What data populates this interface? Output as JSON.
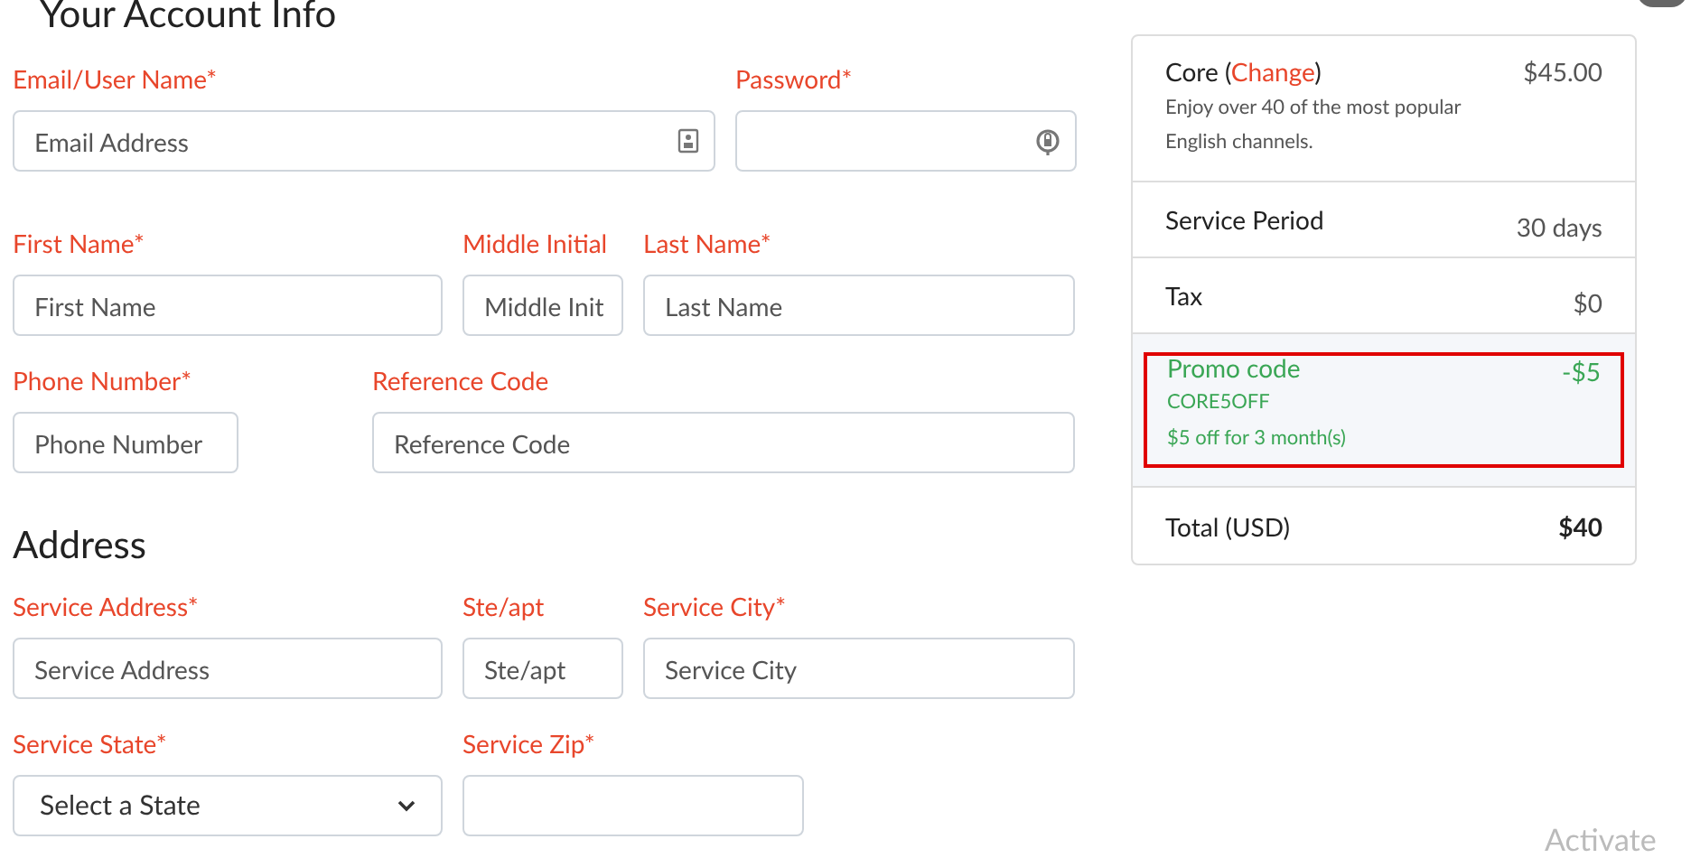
{
  "account": {
    "title": "Your Account Info",
    "fields": [
      {
        "label": "Email/User Name*",
        "placeholder": "Email Address",
        "kind": "email"
      },
      {
        "label": "Password*",
        "kind": "password"
      },
      {
        "label": "First Name*",
        "placeholder": "First Name",
        "kind": "text"
      },
      {
        "label": "Middle Initial",
        "placeholder": "Middle Init",
        "kind": "text"
      },
      {
        "label": "Last Name*",
        "placeholder": "Last Name",
        "kind": "text"
      },
      {
        "label": "Phone Number*",
        "placeholder": "Phone Number",
        "kind": "text"
      },
      {
        "label": "Reference Code",
        "placeholder": "Reference Code",
        "kind": "text"
      }
    ]
  },
  "address": {
    "title": "Address",
    "fields": [
      {
        "label": "Service Address*",
        "placeholder": "Service Address",
        "kind": "text"
      },
      {
        "label": "Ste/apt",
        "placeholder": "Ste/apt",
        "kind": "text"
      },
      {
        "label": "Service City*",
        "placeholder": "Service City",
        "kind": "text"
      },
      {
        "label": "Service State*",
        "value": "Select a State",
        "kind": "select"
      },
      {
        "label": "Service Zip*",
        "kind": "text"
      }
    ]
  },
  "package": {
    "plan": {
      "name": "Core",
      "open": "(",
      "link": "Change",
      "close": ")",
      "price": "$45.00",
      "description": "Enjoy over 40 of the most popular English channels."
    },
    "rows": [
      {
        "label": "Service Period",
        "value": "30 days",
        "kind": "line"
      },
      {
        "label": "Tax",
        "value": "$0",
        "kind": "line"
      },
      {
        "label": "Promo code",
        "code": "CORE5OFF",
        "note": "$5 off for 3 month(s)",
        "value": "-$5",
        "kind": "promo",
        "highlighted": true
      },
      {
        "label": "Total (USD)",
        "value": "$40",
        "kind": "total"
      }
    ]
  },
  "watermark_text": "Activate"
}
